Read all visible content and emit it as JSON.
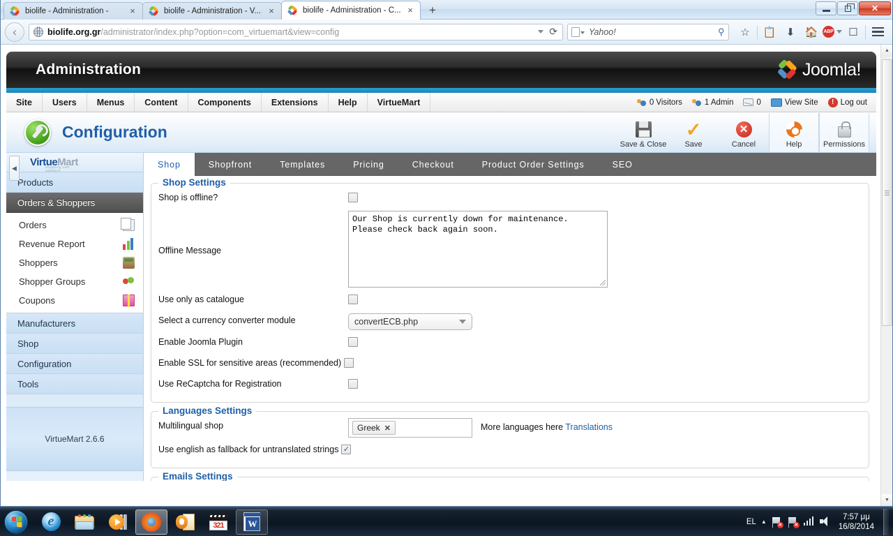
{
  "browser": {
    "tabs": [
      {
        "title": "biolife - Administration -",
        "active": false
      },
      {
        "title": "biolife - Administration - V...",
        "active": false
      },
      {
        "title": "biolife - Administration - C...",
        "active": true
      }
    ],
    "new_tab_label": "+",
    "close_label": "×",
    "url_host": "biolife.org.gr",
    "url_path": "/administrator/index.php?option=com_virtuemart&view=config",
    "search_placeholder": "Yahoo!",
    "reload_label": "⟳",
    "back_label": "←",
    "toolbar_icons": [
      "bookmark-star-icon",
      "reading-list-icon",
      "downloads-icon",
      "home-icon",
      "adblock-icon",
      "tab-groups-icon",
      "menu-icon"
    ],
    "adblock_label": "ABP",
    "window_buttons": {
      "minimize": "—",
      "restore": "❐",
      "close": "✕"
    }
  },
  "admin": {
    "header_title": "Administration",
    "brand": "Joomla!",
    "brand_sup": "®",
    "menu": [
      "Site",
      "Users",
      "Menus",
      "Content",
      "Components",
      "Extensions",
      "Help",
      "VirtueMart"
    ],
    "status": {
      "visitors": "0 Visitors",
      "admins": "1 Admin",
      "messages": "0",
      "view_site": "View Site",
      "logout": "Log out"
    }
  },
  "page": {
    "title": "Configuration",
    "toolbar": [
      {
        "label": "Save & Close",
        "icon": "save-icon",
        "boxed": false
      },
      {
        "label": "Save",
        "icon": "check-icon",
        "boxed": false
      },
      {
        "label": "Cancel",
        "icon": "cancel-icon",
        "boxed": false
      },
      {
        "label": "Help",
        "icon": "help-icon",
        "boxed": true
      },
      {
        "label": "Permissions",
        "icon": "lock-icon",
        "boxed": true
      }
    ]
  },
  "sidebar": {
    "logo_virtue": "Virtue",
    "logo_mart": "Mart",
    "logo_tagline": "shopping cart software",
    "collapse_label": "◀",
    "items": [
      {
        "label": "Products",
        "active": false
      },
      {
        "label": "Orders & Shoppers",
        "active": true
      }
    ],
    "subitems": [
      {
        "label": "Orders",
        "icon": "orders-icon"
      },
      {
        "label": "Revenue Report",
        "icon": "chart-icon"
      },
      {
        "label": "Shoppers",
        "icon": "shoppers-icon"
      },
      {
        "label": "Shopper Groups",
        "icon": "shopper-groups-icon"
      },
      {
        "label": "Coupons",
        "icon": "gift-icon"
      }
    ],
    "items_after": [
      {
        "label": "Manufacturers",
        "active": false
      },
      {
        "label": "Shop",
        "active": false
      },
      {
        "label": "Configuration",
        "active": false
      },
      {
        "label": "Tools",
        "active": false
      }
    ],
    "version": "VirtueMart 2.6.6"
  },
  "tabs": [
    {
      "label": "Shop",
      "active": true
    },
    {
      "label": "Shopfront",
      "active": false
    },
    {
      "label": "Templates",
      "active": false
    },
    {
      "label": "Pricing",
      "active": false
    },
    {
      "label": "Checkout",
      "active": false
    },
    {
      "label": "Product Order Settings",
      "active": false
    },
    {
      "label": "SEO",
      "active": false
    }
  ],
  "shop_settings": {
    "legend": "Shop Settings",
    "shop_offline_label": "Shop is offline?",
    "shop_offline_checked": false,
    "offline_message_label": "Offline Message",
    "offline_message_value": "Our Shop is currently down for maintenance. Please check back again soon.",
    "catalogue_label": "Use only as catalogue",
    "catalogue_checked": false,
    "currency_label": "Select a currency converter module",
    "currency_value": "convertECB.php",
    "joomla_plugin_label": "Enable Joomla Plugin",
    "joomla_plugin_checked": false,
    "ssl_label": "Enable SSL for sensitive areas (recommended)",
    "ssl_checked": false,
    "recaptcha_label": "Use ReCaptcha for Registration",
    "recaptcha_checked": false
  },
  "languages_settings": {
    "legend": "Languages Settings",
    "multilingual_label": "Multilingual shop",
    "multilingual_chip": "Greek",
    "chip_remove": "✕",
    "more_languages_text": "More languages here",
    "translations_link": "Translations",
    "fallback_label": "Use english as fallback for untranslated strings",
    "fallback_checked": true,
    "check_glyph": "✓"
  },
  "emails_settings": {
    "legend": "Emails Settings"
  },
  "taskbar": {
    "start_label": "Start",
    "apps": [
      {
        "name": "internet-explorer",
        "label": "Internet Explorer",
        "open": false
      },
      {
        "name": "windows-explorer",
        "label": "Windows Explorer",
        "open": false
      },
      {
        "name": "windows-media-player",
        "label": "Windows Media Player",
        "open": false
      },
      {
        "name": "firefox",
        "label": "Mozilla Firefox",
        "open": true
      },
      {
        "name": "outlook",
        "label": "Microsoft Outlook",
        "open": false
      },
      {
        "name": "media-player-classic",
        "label": "Media Player Classic",
        "open": false
      },
      {
        "name": "word",
        "label": "Microsoft Word",
        "open": true
      }
    ],
    "ie_glyph": "e",
    "word_glyph": "W",
    "kmp_digits": "321",
    "tray": {
      "language": "EL",
      "show_hidden": "▲",
      "time": "7:57 μμ",
      "date": "16/8/2014"
    }
  }
}
